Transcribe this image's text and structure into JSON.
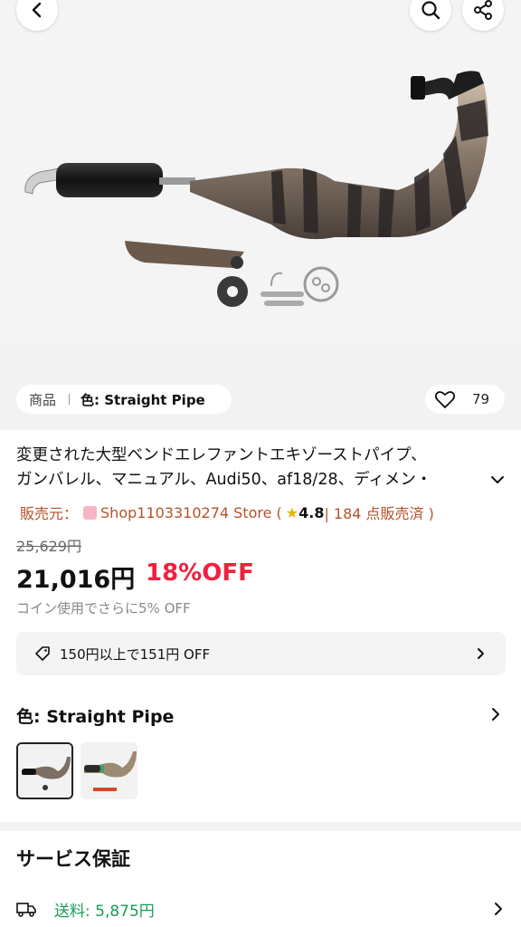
{
  "header": {
    "back_icon": "chevron-left-icon",
    "search_icon": "search-icon",
    "share_icon": "share-icon"
  },
  "variant_chip": {
    "tag": "商品",
    "label": "色: Straight Pipe"
  },
  "favorites": {
    "icon": "heart-icon",
    "count": "79"
  },
  "product": {
    "title_line1": "変更された大型ベンドエレファントエキゾーストパイプ、",
    "title_line2": "ガンバレル、マニュアル、Audi50、af18/28、ディメン・"
  },
  "seller": {
    "prefix": "販売元：",
    "store": "Shop1103310274 Store (",
    "rating": "4.8",
    "sold": " | 184 点販売済 )"
  },
  "pricing": {
    "original": "25,629円",
    "current": "21,016円",
    "discount": "18%OFF",
    "coin_note": "コイン使用でさらに5% OFF"
  },
  "coupon": {
    "icon": "tag-icon",
    "text": "150円以上で151円 OFF"
  },
  "color_section": {
    "heading": "色: Straight Pipe"
  },
  "service": {
    "heading": "サービス保証",
    "shipping_icon": "truck-icon",
    "shipping_label": "送料:  5,875円"
  },
  "colors": {
    "discount_red": "#f0203e",
    "seller_brown": "#b4532c",
    "shipping_green": "#1c9c57"
  }
}
